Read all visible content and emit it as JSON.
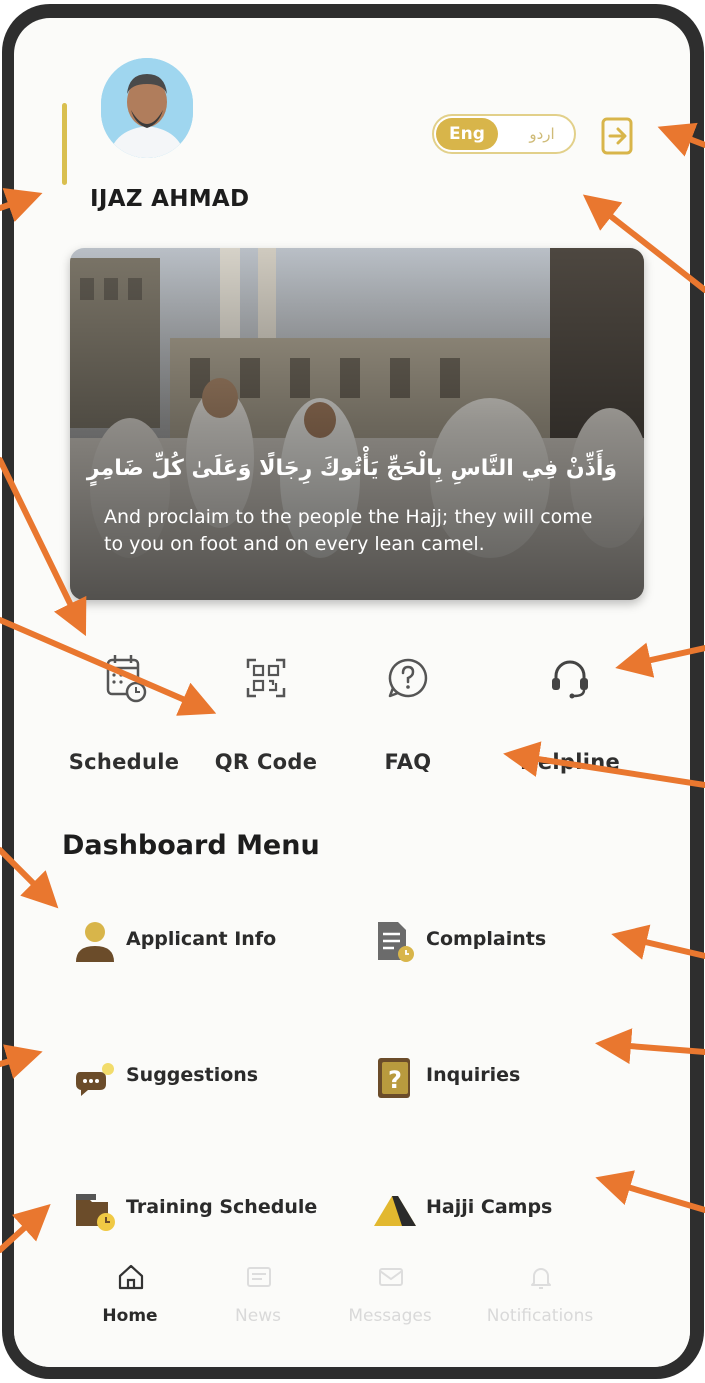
{
  "profile": {
    "name": "IJAZ AHMAD",
    "avatar_icon": "user-photo"
  },
  "language": {
    "active": "Eng",
    "alternate": "اردو"
  },
  "header": {
    "logout_icon": "logout-icon"
  },
  "banner": {
    "arabic": "وَأَذِّنْ فِي النَّاسِ بِالْحَجِّ يَأْتُوكَ رِجَالًا وَعَلَىٰ كُلِّ ضَامِرٍ",
    "english": "And proclaim to the people the Hajj; they will come to you on foot and on every lean camel."
  },
  "quick_actions": [
    {
      "label": "Schedule",
      "icon": "calendar-clock-icon"
    },
    {
      "label": "QR Code",
      "icon": "qr-code-icon"
    },
    {
      "label": "FAQ",
      "icon": "question-circle-icon"
    },
    {
      "label": "Helpline",
      "icon": "headset-icon"
    }
  ],
  "dashboard": {
    "title": "Dashboard Menu",
    "items": [
      {
        "label": "Applicant Info",
        "icon": "person-icon"
      },
      {
        "label": "Complaints",
        "icon": "document-clock-icon"
      },
      {
        "label": "Suggestions",
        "icon": "chat-bubble-icon"
      },
      {
        "label": "Inquiries",
        "icon": "question-book-icon"
      },
      {
        "label": "Training Schedule",
        "icon": "folder-clock-icon"
      },
      {
        "label": "Hajji Camps",
        "icon": "tent-icon"
      }
    ]
  },
  "bottom_nav": [
    {
      "label": "Home",
      "icon": "home-icon",
      "active": true
    },
    {
      "label": "News",
      "icon": "news-icon",
      "active": false
    },
    {
      "label": "Messages",
      "icon": "envelope-icon",
      "active": false
    },
    {
      "label": "Notifications",
      "icon": "bell-icon",
      "active": false
    }
  ],
  "colors": {
    "accent": "#d8b54a",
    "icon_brown": "#8a6a3a",
    "arrow": "#e9772f"
  }
}
